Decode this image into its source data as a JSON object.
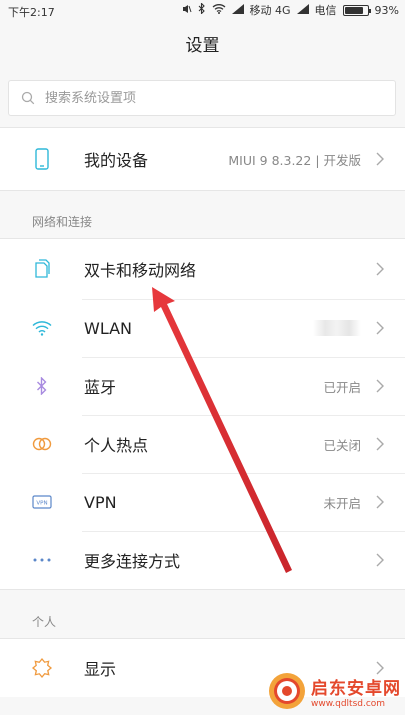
{
  "status_bar": {
    "time": "下午2:17",
    "carrier1": "移动 4G",
    "carrier2": "电信",
    "battery_percent": "93%",
    "battery_level": 0.93
  },
  "header": {
    "title": "设置"
  },
  "search": {
    "placeholder": "搜索系统设置项"
  },
  "device": {
    "label": "我的设备",
    "value": "MIUI 9 8.3.22 | 开发版"
  },
  "network": {
    "section_title": "网络和连接",
    "items": [
      {
        "label": "双卡和移动网络",
        "value": "",
        "icon": "sim-card-icon"
      },
      {
        "label": "WLAN",
        "value": "",
        "icon": "wifi-icon"
      },
      {
        "label": "蓝牙",
        "value": "已开启",
        "icon": "bluetooth-icon"
      },
      {
        "label": "个人热点",
        "value": "已关闭",
        "icon": "hotspot-icon"
      },
      {
        "label": "VPN",
        "value": "未开启",
        "icon": "vpn-icon"
      },
      {
        "label": "更多连接方式",
        "value": "",
        "icon": "more-dots-icon"
      }
    ]
  },
  "personal": {
    "section_title": "个人",
    "items": [
      {
        "label": "显示",
        "value": "",
        "icon": "display-sun-icon"
      }
    ]
  },
  "watermark": {
    "title": "启东安卓网",
    "url": "www.qdltsd.com"
  },
  "colors": {
    "accent_icon": "#2fb8d9",
    "annotation_arrow": "#e8393d",
    "watermark": "#e4482c"
  }
}
